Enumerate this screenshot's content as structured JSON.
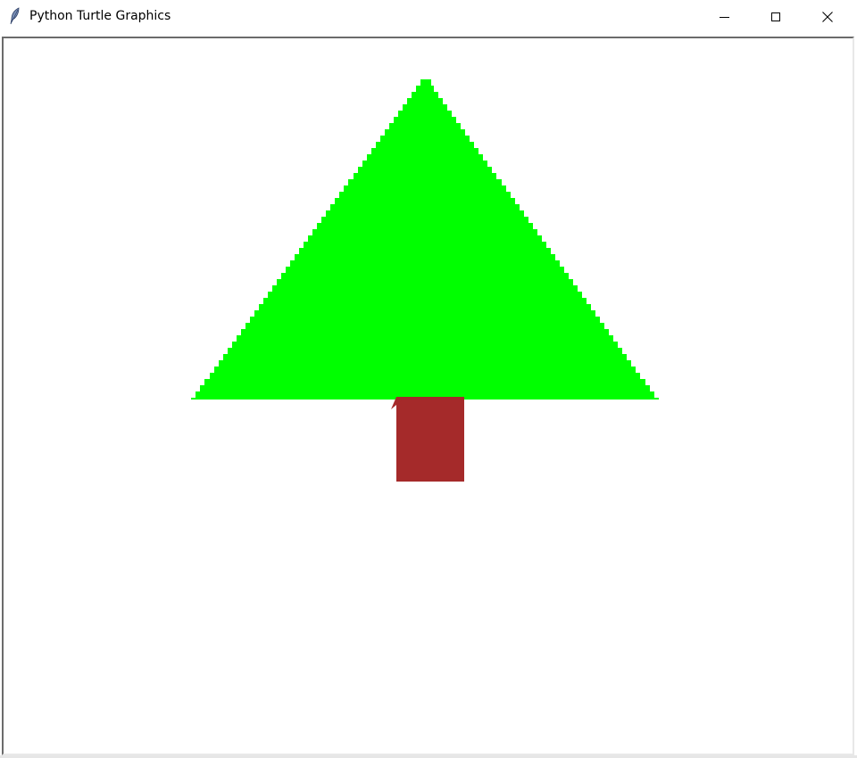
{
  "window": {
    "title": "Python Turtle Graphics",
    "icon": "feather-icon",
    "controls": {
      "minimize": "minimize-icon",
      "maximize": "maximize-icon",
      "close": "close-icon"
    }
  },
  "drawing": {
    "background_color": "#ffffff",
    "tree_foliage_color": "#00ff00",
    "tree_trunk_color": "#a52a2a",
    "turtle_color": "#a52a2a",
    "shapes": [
      "tree-foliage-triangle",
      "tree-trunk-rectangle",
      "turtle-cursor"
    ]
  }
}
